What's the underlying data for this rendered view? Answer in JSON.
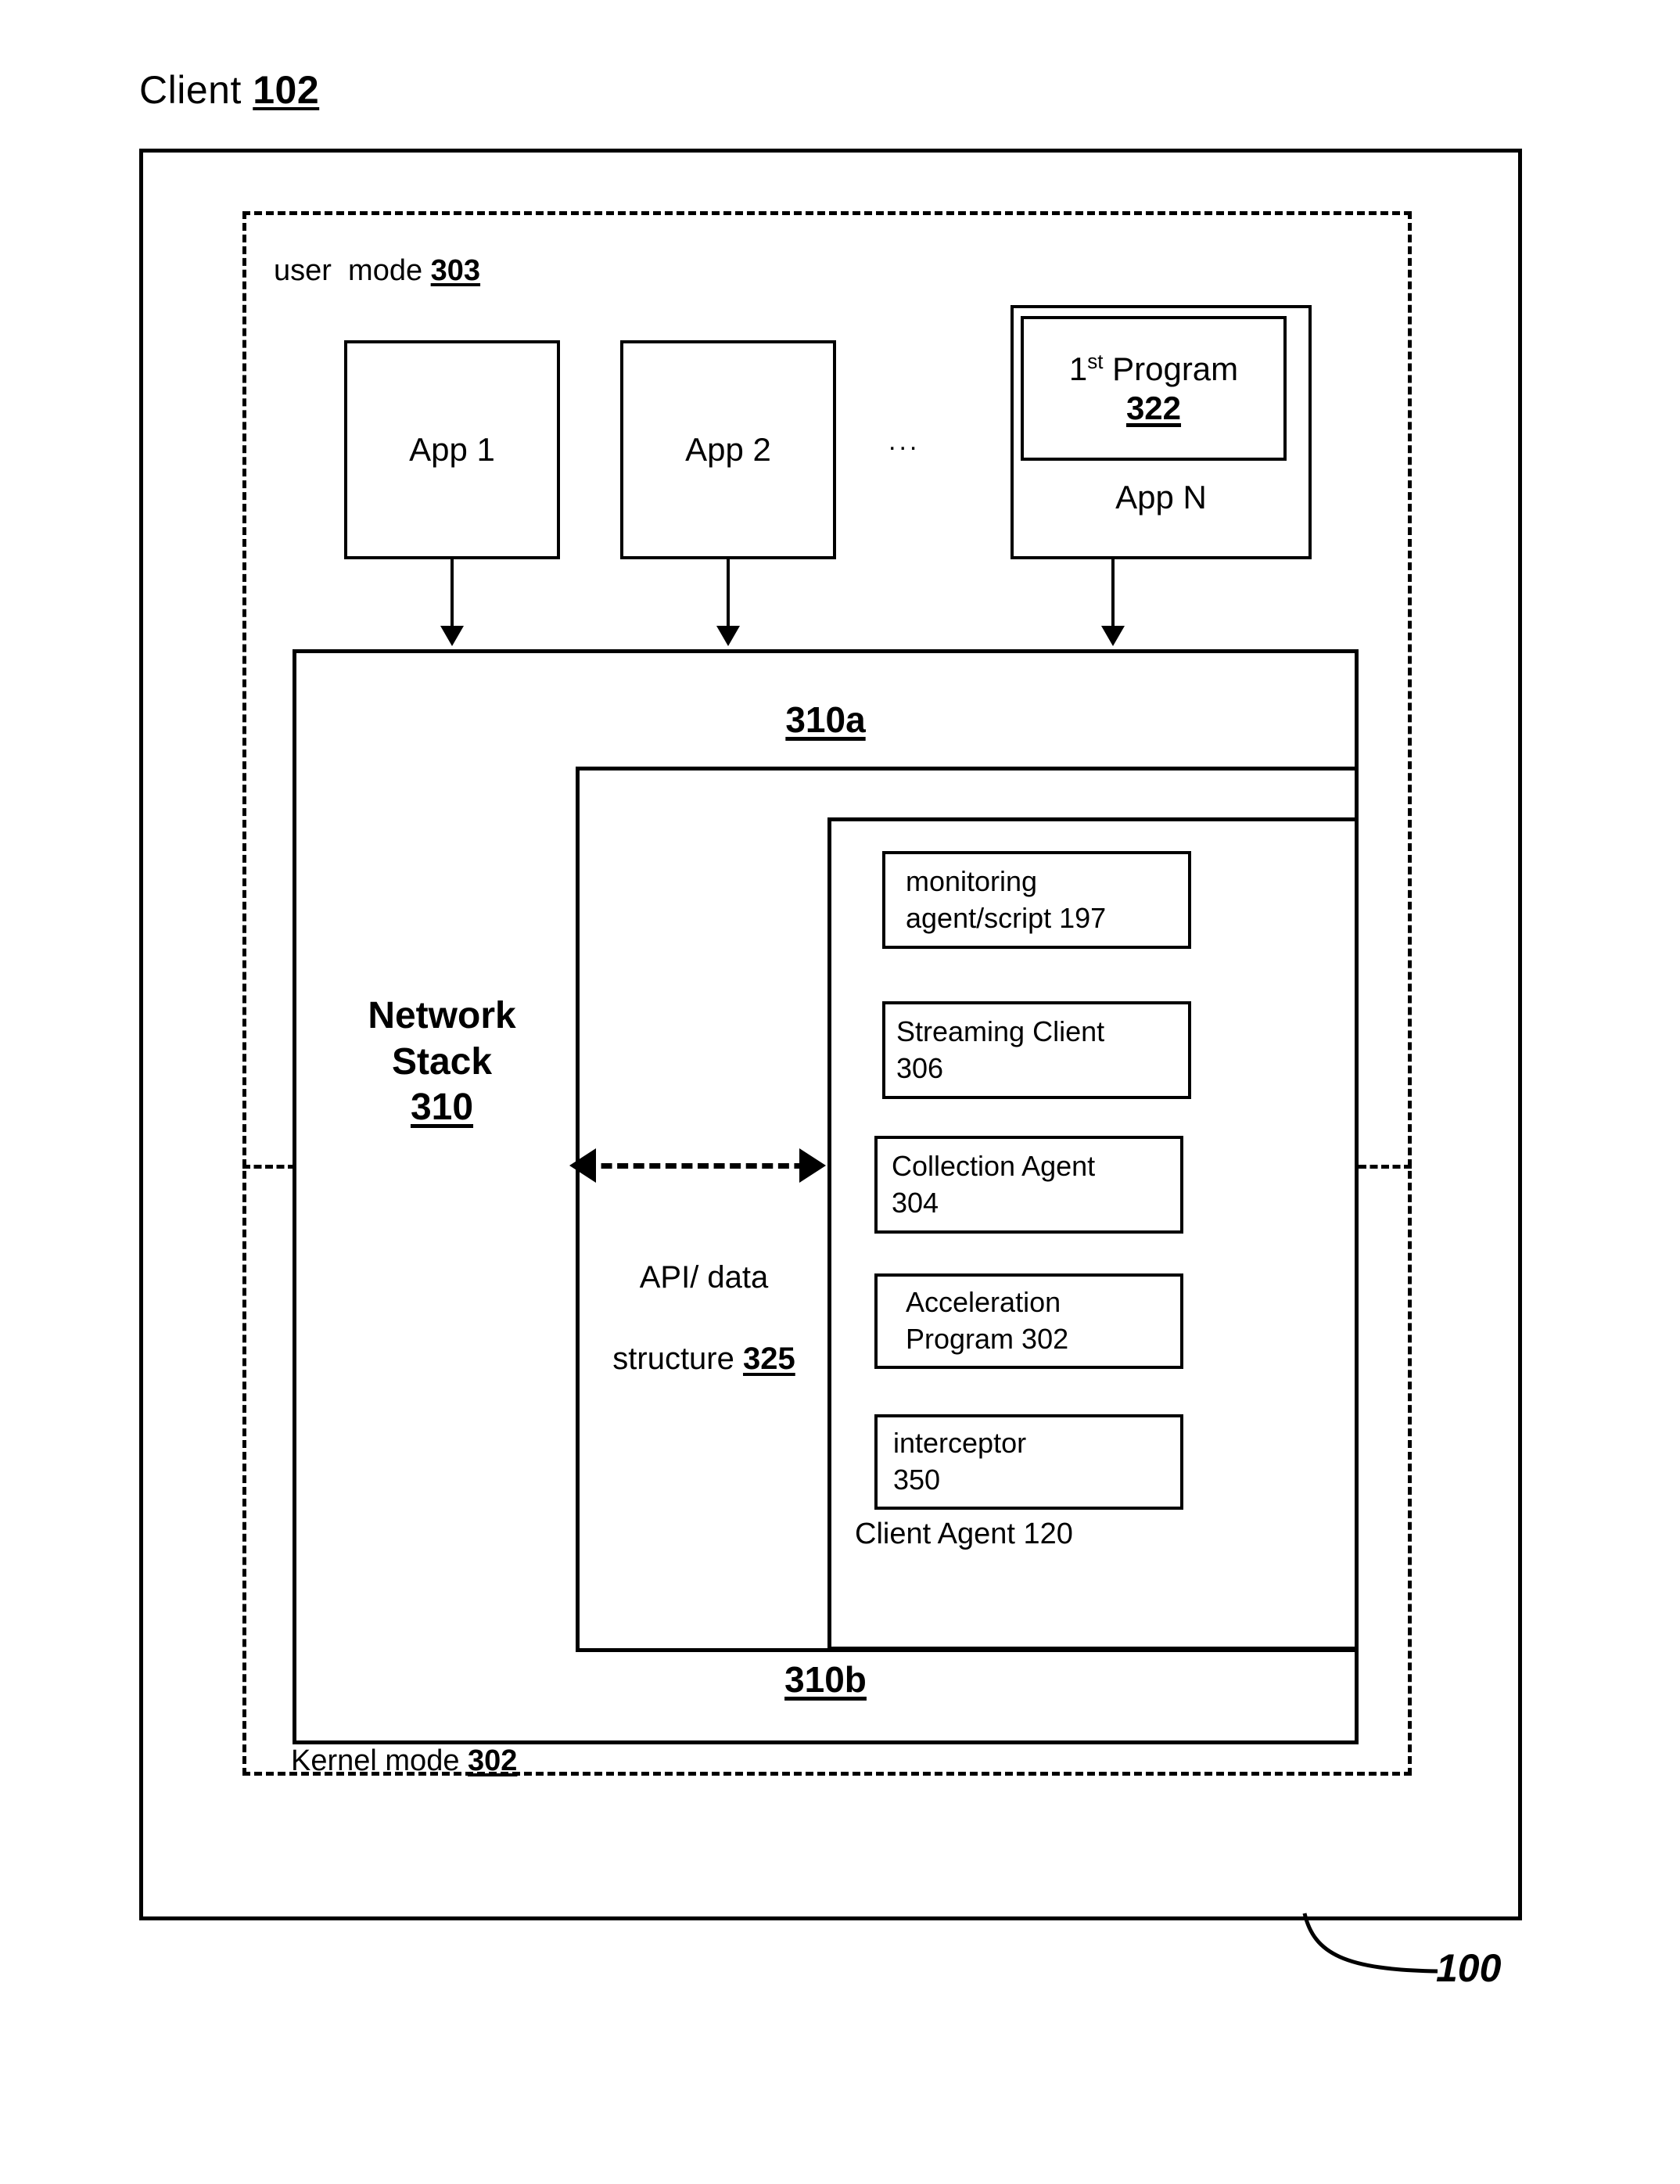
{
  "figure": {
    "title_label": "Client",
    "title_ref": "102",
    "ref_number": "100"
  },
  "modes": {
    "user_mode_label": "user  mode ",
    "user_mode_ref": "303",
    "kernel_mode_label": "Kernel mode ",
    "kernel_mode_ref": "302"
  },
  "applications": {
    "app1": "App 1",
    "app2": "App 2",
    "ellipsis": "...",
    "app_n": "App N",
    "first_program_line1": "1",
    "first_program_sup": "st",
    "first_program_line1b": " Program",
    "first_program_ref": "322"
  },
  "network_stack": {
    "name_line1": "Network",
    "name_line2": "Stack",
    "ref": "310",
    "band_top_label": "310a",
    "band_bottom_label": "310b"
  },
  "api": {
    "line1": "API/ data",
    "line2": "structure ",
    "ref": "325"
  },
  "client_agent": {
    "label": "Client Agent 120",
    "items": [
      {
        "line1": "monitoring",
        "line2": "agent/script 197"
      },
      {
        "line1": "Streaming Client",
        "line2": "306"
      },
      {
        "line1": "Collection Agent",
        "line2": "304"
      },
      {
        "line1": "Acceleration",
        "line2": "Program 302"
      },
      {
        "line1": "interceptor",
        "line2": "350"
      }
    ]
  },
  "colors": {
    "stroke": "#000000",
    "background": "#ffffff"
  }
}
